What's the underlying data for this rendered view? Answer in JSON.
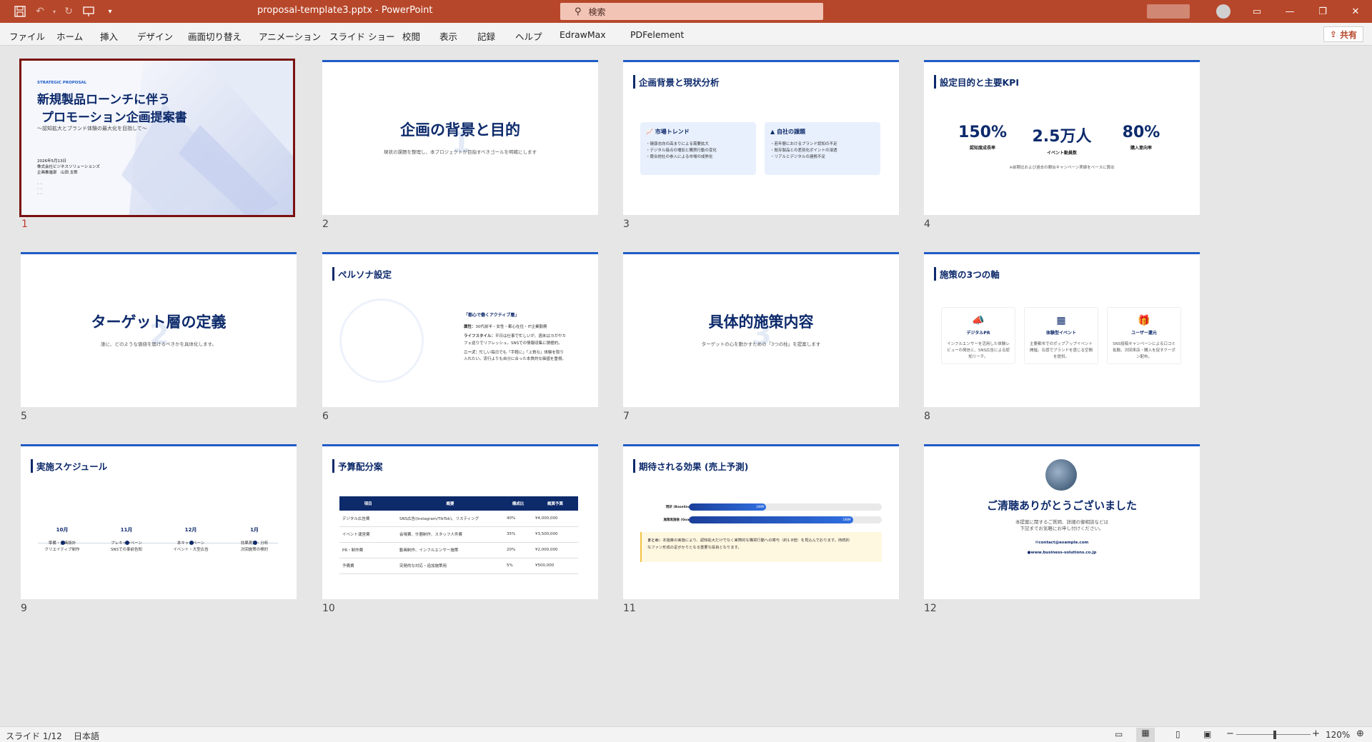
{
  "app": {
    "doc_title": "proposal-template3.pptx  -  PowerPoint",
    "search_placeholder": "検索",
    "share_label": "共有"
  },
  "menu": [
    "ファイル",
    "ホーム",
    "挿入",
    "デザイン",
    "画面切り替え",
    "アニメーション",
    "スライド ショー",
    "校閲",
    "表示",
    "記録",
    "ヘルプ",
    "EdrawMax",
    "PDFelement"
  ],
  "slides": {
    "nums": [
      "1",
      "2",
      "3",
      "4",
      "5",
      "6",
      "7",
      "8",
      "9",
      "10",
      "11",
      "12"
    ],
    "s1": {
      "tag": "STRATEGIC PROPOSAL",
      "title1": "新規製品ローンチに伴う",
      "title2": "プロモーション企画提案書",
      "subtitle": "〜認知拡大とブランド体験の最大化を目指して〜",
      "date": "2026年5月13日",
      "company": "株式会社ビジネスソリューションズ",
      "author": "企画推進部　山田 太郎"
    },
    "s2": {
      "title": "企画の背景と目的",
      "sub": "現状の課題を整理し、本プロジェクトが目指すべきゴールを明確にします",
      "ghost": "1"
    },
    "s3": {
      "title": "企画背景と現状分析",
      "card1_title": "市場トレンド",
      "card1_items": [
        "・健康志向の高まりによる需要拡大",
        "・デジタル接点の増加と購買行動の変化",
        "・競合他社の参入による市場の成熟化"
      ],
      "card2_title": "自社の課題",
      "card2_items": [
        "・若年層におけるブランド認知の不足",
        "・既存製品との差別化ポイントの浸透",
        "・リアルとデジタルの連携不足"
      ]
    },
    "s4": {
      "title": "設定目的と主要KPI",
      "kpis": [
        {
          "v": "150%",
          "l": "認知度成長率"
        },
        {
          "v": "2.5万人",
          "l": "イベント動員数"
        },
        {
          "v": "80%",
          "l": "購入意向率"
        }
      ],
      "note": "※前期比および過去の類似キャンペーン実績をベースに算出"
    },
    "s5": {
      "title": "ターゲット層の定義",
      "sub": "誰に、どのような価値を届けるべきかを具体化します。",
      "ghost": "2"
    },
    "s6": {
      "title": "ペルソナ設定",
      "ptitle": "「都心で働くアクティブ層」",
      "attr_label": "属性：",
      "attr": "30代前半・女性・都心在住・IT企業勤務",
      "life_label": "ライフスタイル：",
      "life1": "平日は仕事で忙しいが、週末はヨガやカ",
      "life2": "フェ巡りでリフレッシュ。SNSでの情報収集に積極的。",
      "needs_label": "ニーズ：",
      "needs1": "忙しい毎日でも「手軽に」「上質な」体験を取り",
      "needs2": "入れたい。流行よりも自分に合った本質的な価値を重視。"
    },
    "s7": {
      "title": "具体的施策内容",
      "sub": "ターゲットの心を動かすための「3つの柱」を提案します",
      "ghost": "3"
    },
    "s8": {
      "title": "施策の3つの軸",
      "axes": [
        {
          "t": "デジタルPR",
          "d": "インフルエンサーを活用した体験レビューの発信と、SNS広告による認知リーチ。"
        },
        {
          "t": "体験型イベント",
          "d": "主要都市でのポップアップイベント開催。五感でブランドを感じる空間を提供。"
        },
        {
          "t": "ユーザー還元",
          "d": "SNS投稿キャンペーンによる口コミ拡散。次回来店・購入を促すクーポン配布。"
        }
      ]
    },
    "s9": {
      "title": "実施スケジュール",
      "items": [
        {
          "m": "10月",
          "d1": "準備・企画設計",
          "d2": "クリエイティブ制作"
        },
        {
          "m": "11月",
          "d1": "プレキャンペーン",
          "d2": "SNSでの事前告知"
        },
        {
          "m": "12月",
          "d1": "本キャンペーン",
          "d2": "イベント・大型広告"
        },
        {
          "m": "1月",
          "d1": "効果測定・分析",
          "d2": "次回施策の検討"
        }
      ]
    },
    "s10": {
      "title": "予算配分案",
      "headers": [
        "項目",
        "概要",
        "構成比",
        "概算予算"
      ],
      "rows": [
        [
          "デジタル広告費",
          "SNS広告(Instagram/TikTok)、リスティング",
          "40%",
          "¥4,000,000"
        ],
        [
          "イベント運営費",
          "会場費、什器制作、スタッフ人件費",
          "35%",
          "¥3,500,000"
        ],
        [
          "PR・制作費",
          "動画制作、インフルエンサー施策",
          "20%",
          "¥2,000,000"
        ],
        [
          "予備費",
          "突発的な対応・追加施策用",
          "5%",
          "¥500,000"
        ]
      ]
    },
    "s11": {
      "title": "期待される効果 (売上予測)",
      "bars": [
        {
          "label": "現状 (Baseline)",
          "value": "100M",
          "fill": 0.4
        },
        {
          "label": "施策実施後 (Goal)",
          "value": "180M",
          "fill": 0.85
        }
      ],
      "summary_label": "まとめ：",
      "summary1": "本施策の実施により、認知拡大だけでなく実際的な購買行動への寄与（約1.8倍）を見込んでおります。持続的",
      "summary2": "なファン形成の足がかりとなる重要な投資となります。"
    },
    "s12": {
      "title": "ご清聴ありがとうございました",
      "sub1": "本提案に関するご質問、詳細の御相談などは",
      "sub2": "下記までお気軽にお申し付けください。",
      "email": "contact@example.com",
      "web": "www.business-solutions.co.jp"
    }
  },
  "status": {
    "slide": "スライド 1/12",
    "lang": "日本語",
    "zoom": "120%"
  }
}
